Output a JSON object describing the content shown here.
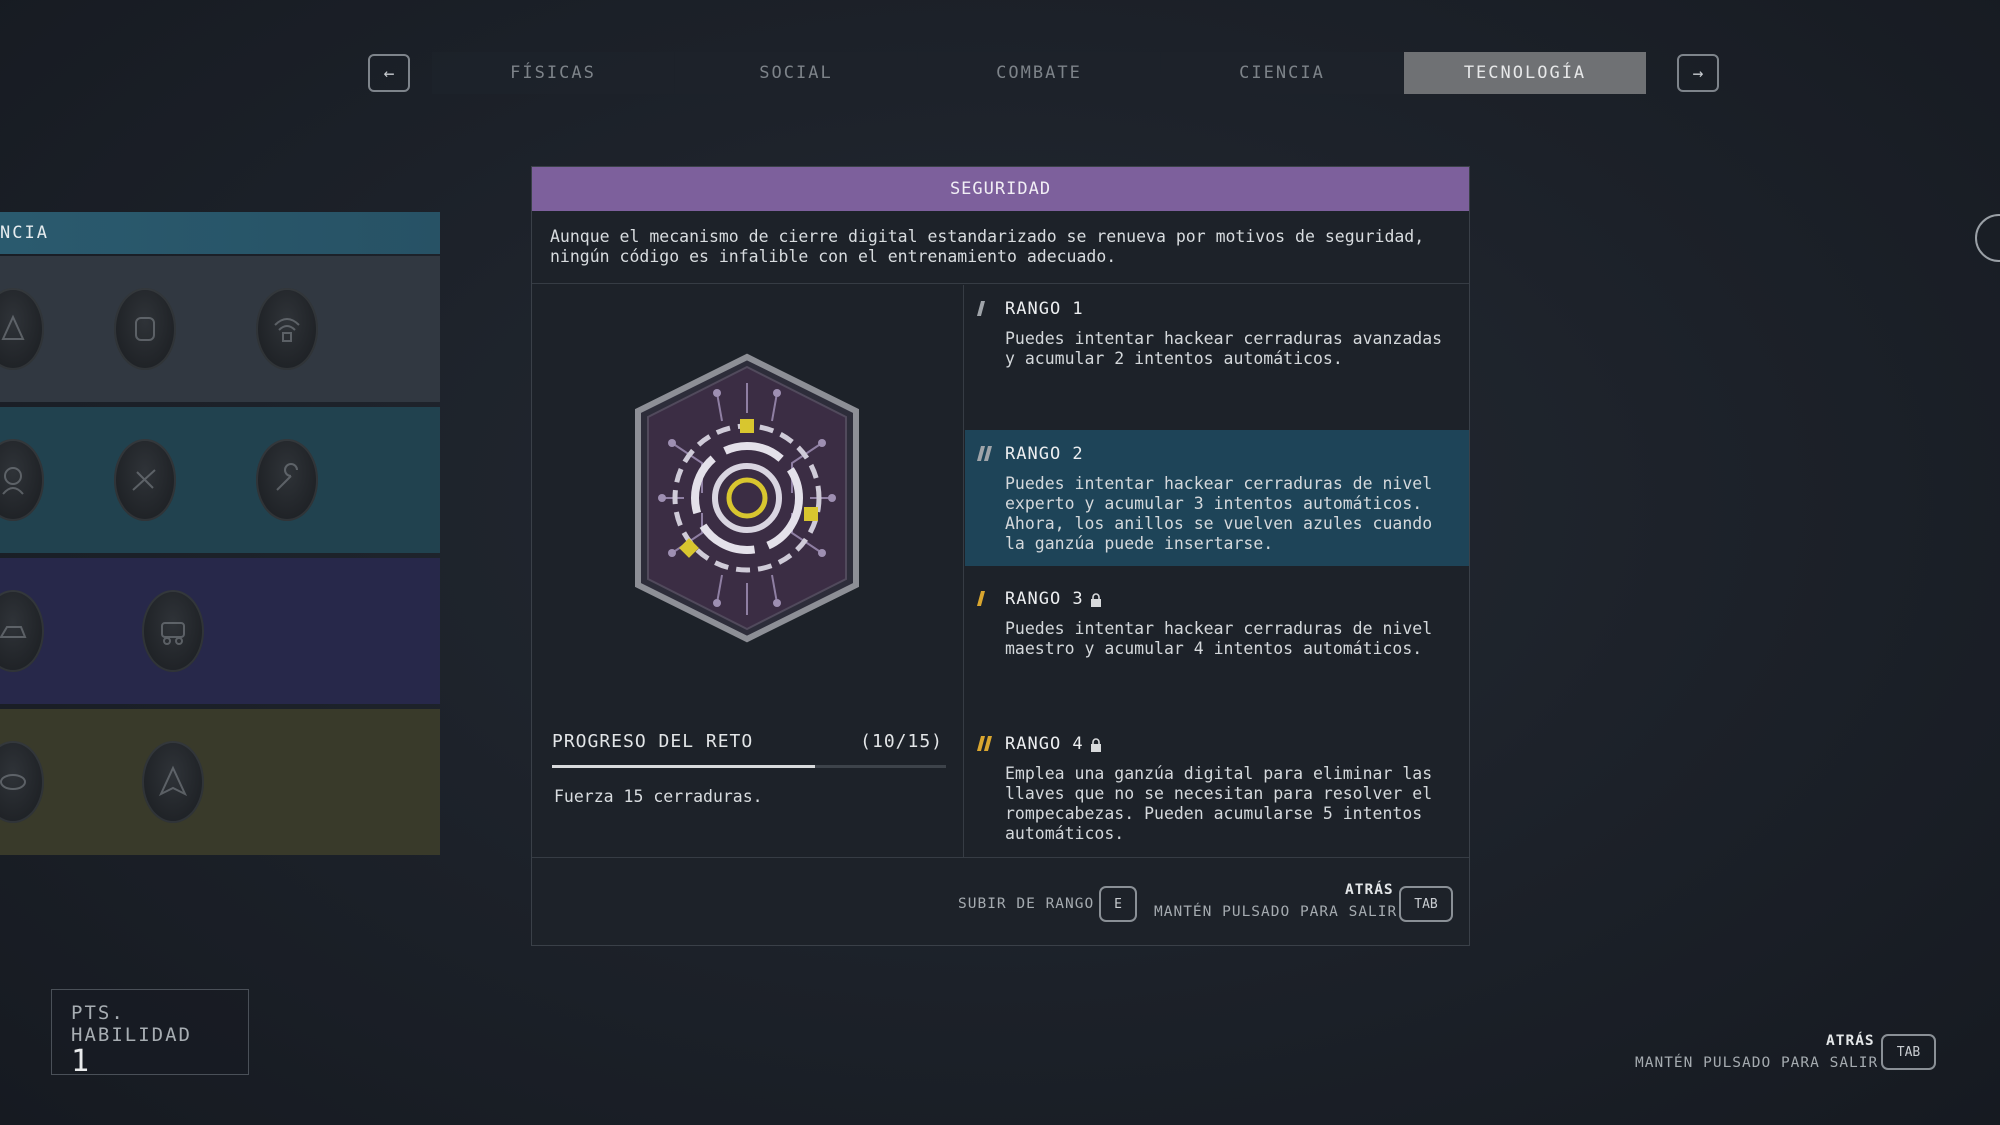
{
  "nav": {
    "prev_icon": "arrow-left-icon",
    "next_icon": "arrow-right-icon",
    "prev_glyph": "←",
    "next_glyph": "→",
    "tabs": [
      {
        "label": "FÍSICAS"
      },
      {
        "label": "SOCIAL"
      },
      {
        "label": "COMBATE"
      },
      {
        "label": "CIENCIA"
      },
      {
        "label": "TECNOLOGÍA",
        "active": true
      }
    ]
  },
  "skill_tree": {
    "header": "NCIA"
  },
  "skill": {
    "name": "SEGURIDAD",
    "accent_color": "#7d609c",
    "description": "Aunque el mecanismo de cierre digital estandarizado se renueva por motivos de seguridad, ningún código es infalible con el entrenamiento adecuado.",
    "challenge": {
      "title": "PROGRESO DEL RETO",
      "count": "(10/15)",
      "progress": 0.667,
      "description": "Fuerza 15 cerraduras."
    },
    "ranks": [
      {
        "title": "RANGO 1",
        "desc": "Puedes intentar hackear cerraduras avanzadas y acumular 2 intentos automáticos.",
        "locked": false
      },
      {
        "title": "RANGO 2",
        "desc": "Puedes intentar hackear cerraduras de nivel experto y acumular 3 intentos automáticos. Ahora, los anillos se vuelven azules cuando la ganzúa puede insertarse.",
        "locked": false,
        "selected": true
      },
      {
        "title": "RANGO 3",
        "desc": "Puedes intentar hackear cerraduras de nivel maestro y acumular 4 intentos automáticos.",
        "locked": true
      },
      {
        "title": "RANGO 4",
        "desc": "Emplea una ganzúa digital para eliminar las llaves que no se necesitan para resolver el rompecabezas. Pueden acumularse 5 intentos automáticos.",
        "locked": true
      }
    ],
    "footer": {
      "rank_up_label": "SUBIR DE RANGO",
      "rank_up_key": "E",
      "back_label": "ATRÁS",
      "hold_label": "MANTÉN PULSADO PARA SALIR",
      "back_key": "TAB"
    }
  },
  "skill_points": {
    "label": "PTS. HABILIDAD",
    "value": "1"
  },
  "global_footer": {
    "back_label": "ATRÁS",
    "hold_label": "MANTÉN PULSADO PARA SALIR",
    "back_key": "TAB"
  }
}
